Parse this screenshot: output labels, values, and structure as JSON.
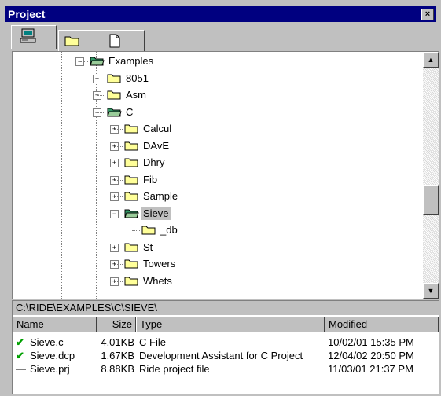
{
  "window": {
    "title": "Project",
    "close_glyph": "×"
  },
  "tabs": [
    {
      "name": "computer-icon"
    },
    {
      "name": "folder-icon"
    },
    {
      "name": "document-icon"
    }
  ],
  "tree": {
    "items": [
      {
        "label": "Examples",
        "expander": "−",
        "icon": "folder-open-icon"
      },
      {
        "label": "8051",
        "expander": "+",
        "icon": "folder-icon"
      },
      {
        "label": "Asm",
        "expander": "+",
        "icon": "folder-icon"
      },
      {
        "label": "C",
        "expander": "−",
        "icon": "folder-open-icon"
      },
      {
        "label": "Calcul",
        "expander": "+",
        "icon": "folder-icon"
      },
      {
        "label": "DAvE",
        "expander": "+",
        "icon": "folder-icon"
      },
      {
        "label": "Dhry",
        "expander": "+",
        "icon": "folder-icon"
      },
      {
        "label": "Fib",
        "expander": "+",
        "icon": "folder-icon"
      },
      {
        "label": "Sample",
        "expander": "+",
        "icon": "folder-icon"
      },
      {
        "label": "Sieve",
        "expander": "−",
        "icon": "folder-open-icon",
        "selected": true
      },
      {
        "label": "_db",
        "icon": "folder-icon"
      },
      {
        "label": "St",
        "expander": "+",
        "icon": "folder-icon"
      },
      {
        "label": "Towers",
        "expander": "+",
        "icon": "folder-icon"
      },
      {
        "label": "Whets",
        "expander": "+",
        "icon": "folder-icon"
      }
    ]
  },
  "scrollbar": {
    "up_glyph": "▲",
    "down_glyph": "▼"
  },
  "files": {
    "path": "C:\\RIDE\\EXAMPLES\\C\\SIEVE\\",
    "columns": {
      "name": "Name",
      "size": "Size",
      "type": "Type",
      "modified": "Modified"
    },
    "rows": [
      {
        "status": "✔",
        "name": "Sieve.c",
        "size": "4.01KB",
        "type": "C File",
        "modified": "10/02/01 15:35 PM"
      },
      {
        "status": "✔",
        "name": "Sieve.dcp",
        "size": "1.67KB",
        "type": "Development Assistant for C Project",
        "modified": "12/04/02 20:50 PM"
      },
      {
        "status": "—",
        "name": "Sieve.prj",
        "size": "8.88KB",
        "type": "Ride project file",
        "modified": "11/03/01 21:37 PM"
      }
    ]
  },
  "colors": {
    "titlebar": "#000080",
    "folder": "#ffff99",
    "open_folder": "#339966",
    "check": "#00a000"
  }
}
